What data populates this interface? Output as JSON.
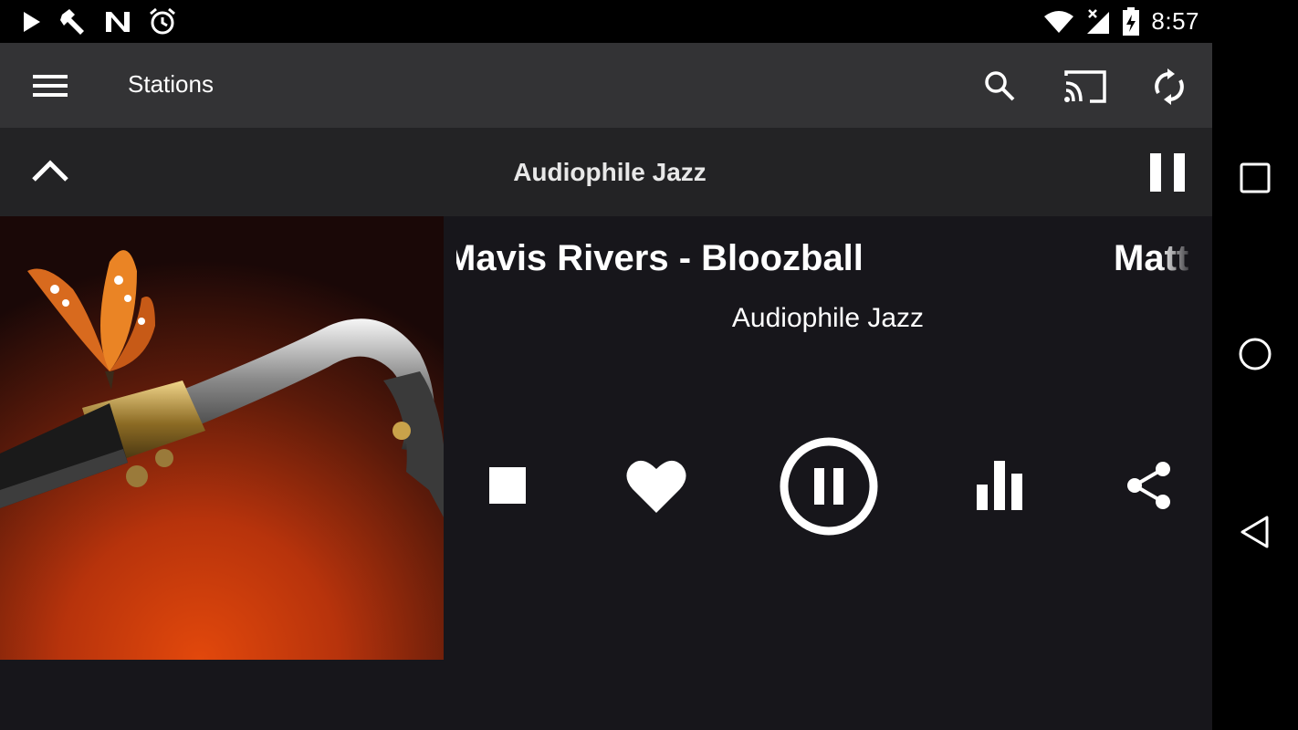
{
  "status_bar": {
    "time": "8:57",
    "left_icons": [
      "play-icon",
      "tools-icon",
      "n-logo-icon",
      "alarm-icon"
    ],
    "right_icons": [
      "wifi-icon",
      "no-signal-icon",
      "battery-charging-icon"
    ]
  },
  "app_bar": {
    "title": "Stations",
    "actions": [
      "search-icon",
      "cast-icon",
      "refresh-icon"
    ]
  },
  "mini_player": {
    "title": "Audiophile Jazz"
  },
  "now_playing": {
    "track": "Mavis Rivers - Bloozball",
    "next_track_fragment": "Matt",
    "station": "Audiophile Jazz"
  },
  "controls": [
    "stop-icon",
    "heart-icon",
    "pause-circle-icon",
    "equalizer-icon",
    "share-icon"
  ],
  "nav_bar": [
    "recents-icon",
    "home-icon",
    "back-icon"
  ]
}
